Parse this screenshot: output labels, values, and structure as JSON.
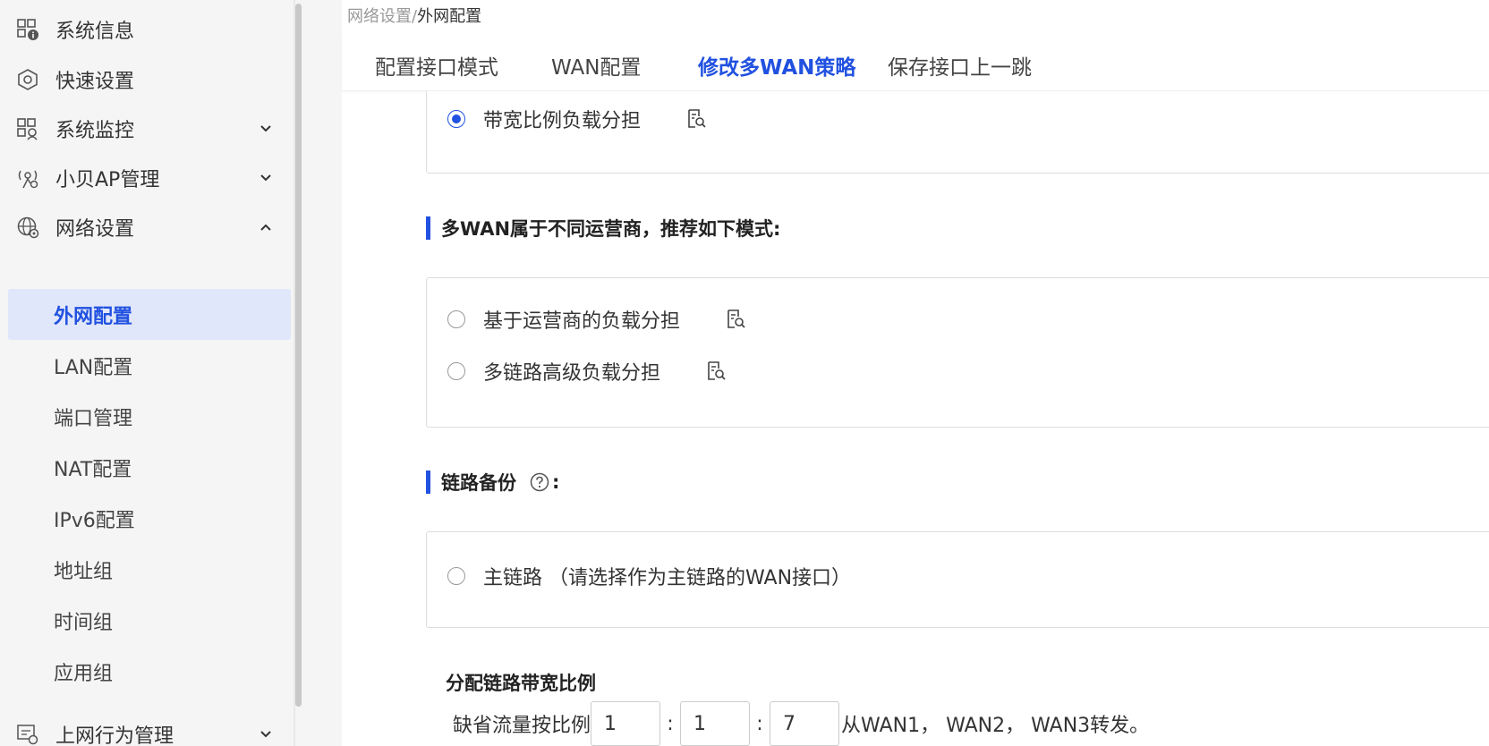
{
  "sidebar": {
    "items": [
      {
        "label": "系统信息",
        "icon": "system-info-icon"
      },
      {
        "label": "快速设置",
        "icon": "quick-setup-icon"
      },
      {
        "label": "系统监控",
        "icon": "system-monitor-icon"
      },
      {
        "label": "小贝AP管理",
        "icon": "ap-manage-icon"
      },
      {
        "label": "网络设置",
        "icon": "network-settings-icon"
      }
    ],
    "sub_items": [
      {
        "label": "外网配置"
      },
      {
        "label": "LAN配置"
      },
      {
        "label": "端口管理"
      },
      {
        "label": "NAT配置"
      },
      {
        "label": "IPv6配置"
      },
      {
        "label": "地址组"
      },
      {
        "label": "时间组"
      },
      {
        "label": "应用组"
      }
    ],
    "bottom_item": {
      "label": "上网行为管理",
      "icon": "behavior-manage-icon"
    }
  },
  "breadcrumb": {
    "parent": "网络设置",
    "separator": "/",
    "current": "外网配置"
  },
  "tabs": [
    {
      "label": "配置接口模式"
    },
    {
      "label": "WAN配置"
    },
    {
      "label": "修改多WAN策略"
    },
    {
      "label": "保存接口上一跳"
    }
  ],
  "options": {
    "bandwidth_ratio": "带宽比例负载分担",
    "section_isp_title": "多WAN属于不同运营商，推荐如下模式:",
    "isp_based": "基于运营商的负载分担",
    "multi_link_advanced": "多链路高级负载分担",
    "section_backup_title": "链路备份",
    "section_backup_colon": ":",
    "main_link": "主链路 （请选择作为主链路的WAN接口）"
  },
  "allocation": {
    "title": "分配链路带宽比例",
    "prefix": "缺省流量按比例",
    "values": [
      "1",
      "1",
      "7"
    ],
    "separator": ":",
    "suffix": "从WAN1， WAN2， WAN3转发。"
  },
  "colors": {
    "accent": "#2151e0",
    "active_bg": "#e1e7fa"
  }
}
